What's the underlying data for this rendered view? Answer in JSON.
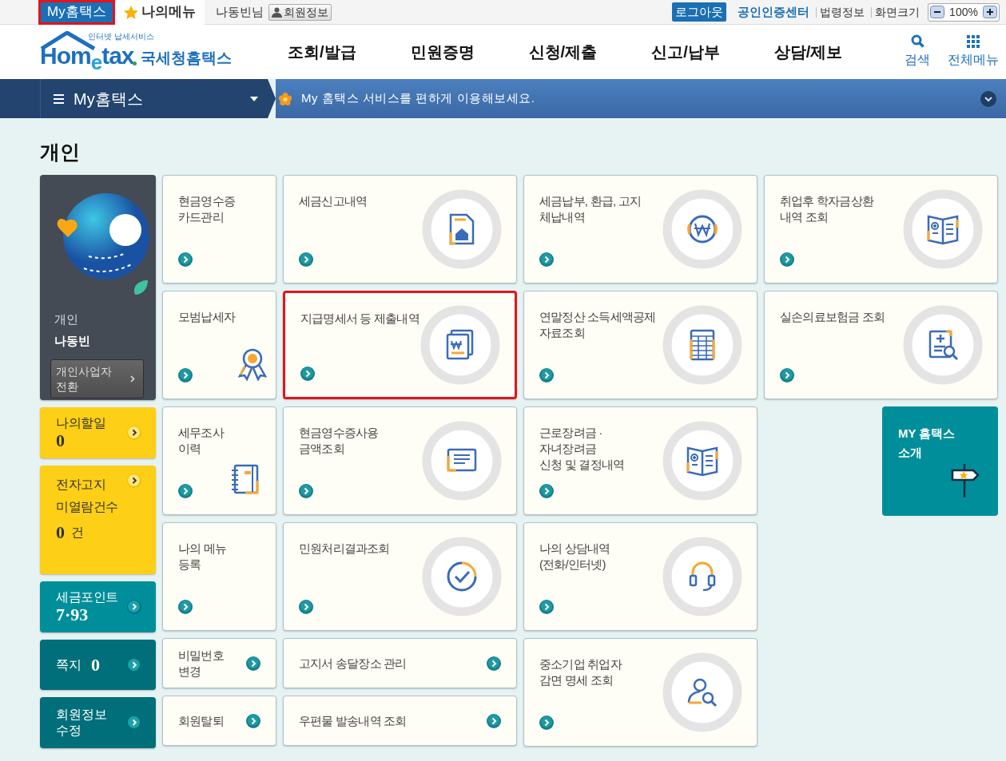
{
  "top_bar": {
    "tabs": [
      {
        "label": "My홈택스",
        "selected": true,
        "highlighted": true
      },
      {
        "label": "나의메뉴",
        "selected": false,
        "highlighted": false
      }
    ],
    "user_name": "나동빈님",
    "member_info_button": "회원정보",
    "logout_button": "로그아웃",
    "cert_center_link": "공인인증센터",
    "links": [
      "법령정보",
      "화면크기"
    ],
    "zoom_value": "100%"
  },
  "logo": {
    "tagline": "인터넷 납세서비스",
    "brand": "Hom$_{e}$tax",
    "name": "국세청홈택스"
  },
  "nav": {
    "items": [
      "조회/발급",
      "민원증명",
      "신청/제출",
      "신고/납부",
      "상담/제보"
    ],
    "search": "검색",
    "all_menu": "전체메뉴"
  },
  "sub_nav": {
    "menu_title": "My홈택스",
    "message": "My 홈택스 서비스를 편하게 이용해보세요."
  },
  "section_title": "개인",
  "profile": {
    "type": "개인",
    "name": "나동빈",
    "switch_button": "개인사업자\n전환"
  },
  "side_cards": [
    {
      "kind": "value-below",
      "label": "나의할일",
      "value": "0",
      "color": "#fdcf16"
    },
    {
      "kind": "notice",
      "label": "전자고지\n미열람건수",
      "value": "0",
      "unit": "건",
      "color": "#fdcf16"
    },
    {
      "kind": "value-below",
      "label": "세금포인트",
      "value": "7·93",
      "color": "#008f9a"
    },
    {
      "kind": "inline",
      "label": "쪽지",
      "value": "0",
      "color": "#006f79"
    },
    {
      "kind": "text",
      "label": "회원정보\n수정",
      "color": "#006f79"
    }
  ],
  "columns": [
    {
      "tiles": [
        {
          "kind": "plain",
          "title": "현금영수증\n카드관리",
          "highlighted": false
        },
        {
          "kind": "small-icon",
          "title": "모범납세자",
          "highlighted": false
        },
        {
          "kind": "small-icon",
          "title": "세무조사\n이력",
          "highlighted": false
        },
        {
          "kind": "plain",
          "title": "나의 메뉴\n등록",
          "highlighted": false
        },
        {
          "kind": "short",
          "title": "비밀번호\n변경",
          "highlighted": false
        },
        {
          "kind": "short",
          "title": "회원탈퇴",
          "highlighted": false
        }
      ]
    },
    {
      "tiles": [
        {
          "kind": "circle",
          "title": "세금신고내역",
          "highlighted": false
        },
        {
          "kind": "circle",
          "title": "지급명세서 등 제출내역",
          "highlighted": true
        },
        {
          "kind": "circle",
          "title": "현금영수증사용\n금액조회",
          "highlighted": false
        },
        {
          "kind": "circle",
          "title": "민원처리결과조회",
          "highlighted": false
        },
        {
          "kind": "short",
          "title": "고지서 송달장소 관리",
          "highlighted": false
        },
        {
          "kind": "short",
          "title": "우편물 발송내역 조회",
          "highlighted": false
        }
      ]
    },
    {
      "tiles": [
        {
          "kind": "circle",
          "title": "세금납부, 환급, 고지\n체납내역",
          "highlighted": false
        },
        {
          "kind": "circle",
          "title": "연말정산 소득세액공제\n자료조회",
          "highlighted": false
        },
        {
          "kind": "circle",
          "title": "근로장려금 ·\n자녀장려금\n신청 및 결정내역",
          "highlighted": false
        },
        {
          "kind": "circle",
          "title": "나의 상담내역\n(전화/인터넷)",
          "highlighted": false
        },
        {
          "kind": "circle",
          "title": "중소기업 취업자\n감면 명세 조회",
          "highlighted": false
        }
      ]
    },
    {
      "tiles": [
        {
          "kind": "circle",
          "title": "취업후 학자금상환\n내역 조회",
          "highlighted": false
        },
        {
          "kind": "circle",
          "title": "실손의료보험금 조회",
          "highlighted": false
        },
        {
          "kind": "promo",
          "title": "MY 홈택스\n소개",
          "highlighted": false
        }
      ]
    }
  ]
}
